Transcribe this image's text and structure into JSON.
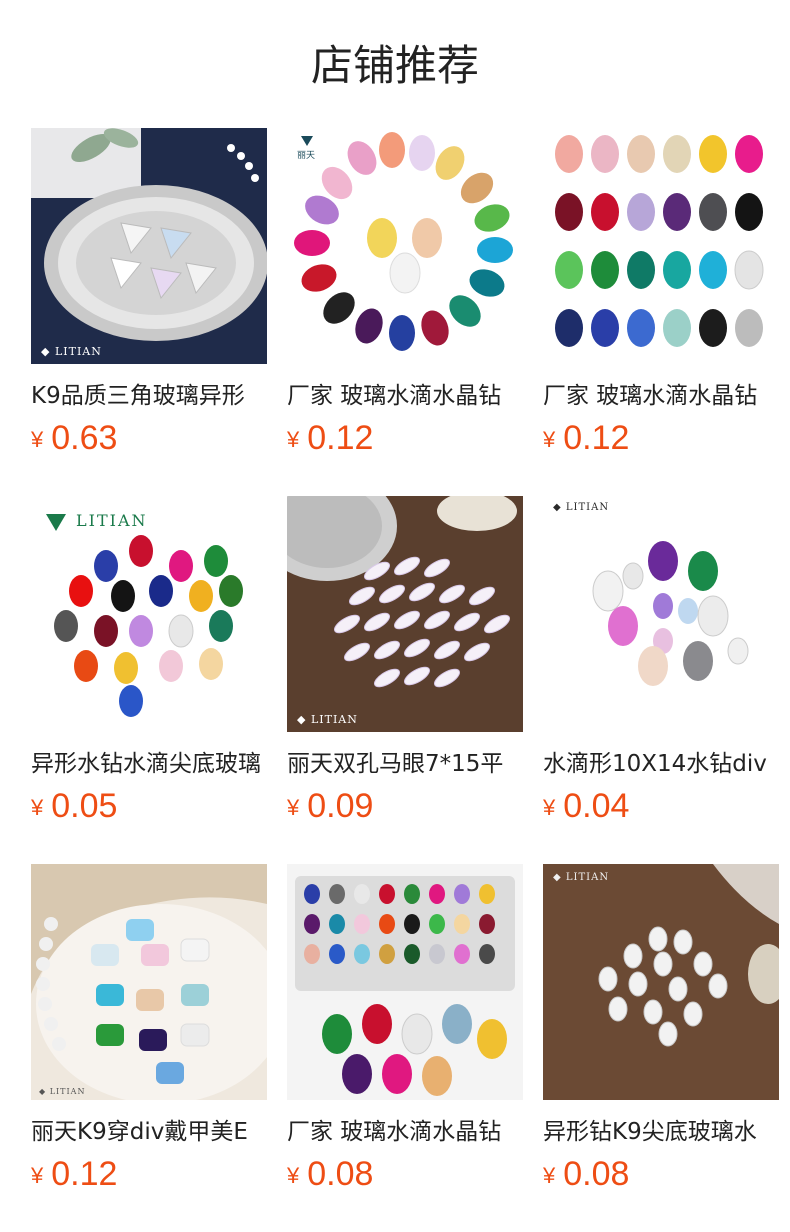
{
  "header": {
    "title": "店铺推荐"
  },
  "currency_symbol": "¥",
  "products": [
    {
      "name": "K9品质三角玻璃异形",
      "price": "0.63",
      "watermark": "LITIAN"
    },
    {
      "name": "厂家 玻璃水滴水晶钻",
      "price": "0.12"
    },
    {
      "name": "厂家 玻璃水滴水晶钻",
      "price": "0.12"
    },
    {
      "name": "异形水钻水滴尖底玻璃",
      "price": "0.05",
      "watermark": "LITIAN"
    },
    {
      "name": "丽天双孔马眼7*15平",
      "price": "0.09",
      "watermark": "LITIAN"
    },
    {
      "name": "水滴形10X14水钻div",
      "price": "0.04",
      "watermark": "LITIAN"
    },
    {
      "name": "丽天K9穿div戴甲美E",
      "price": "0.12",
      "watermark": "LITIAN"
    },
    {
      "name": "厂家 玻璃水滴水晶钻",
      "price": "0.08"
    },
    {
      "name": "异形钻K9尖底玻璃水",
      "price": "0.08",
      "watermark": "LITIAN"
    }
  ],
  "colors": {
    "price": "#ee4d14",
    "title": "#222222"
  }
}
